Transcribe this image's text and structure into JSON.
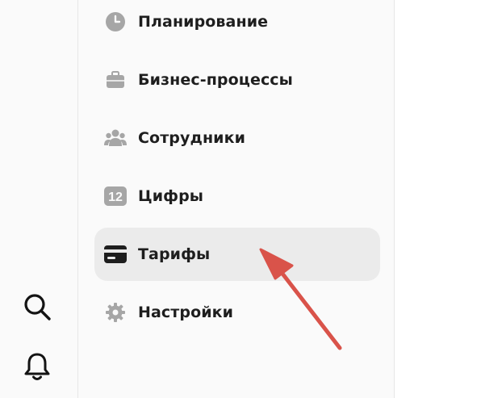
{
  "rail": {
    "search_icon": "search-icon",
    "bell_icon": "bell-icon"
  },
  "menu": {
    "items": [
      {
        "label": "Планирование",
        "icon": "clock-icon"
      },
      {
        "label": "Бизнес-процессы",
        "icon": "briefcase-icon"
      },
      {
        "label": "Сотрудники",
        "icon": "people-icon"
      },
      {
        "label": "Цифры",
        "icon": "numbers-12-icon",
        "icon_text": "12"
      },
      {
        "label": "Тарифы",
        "icon": "credit-card-icon",
        "active": true
      },
      {
        "label": "Настройки",
        "icon": "gear-icon"
      }
    ]
  },
  "colors": {
    "icon_gray": "#a6a6a6",
    "active_bg": "#ebebeb",
    "text": "#1e1e1e",
    "arrow": "#d9534a"
  }
}
